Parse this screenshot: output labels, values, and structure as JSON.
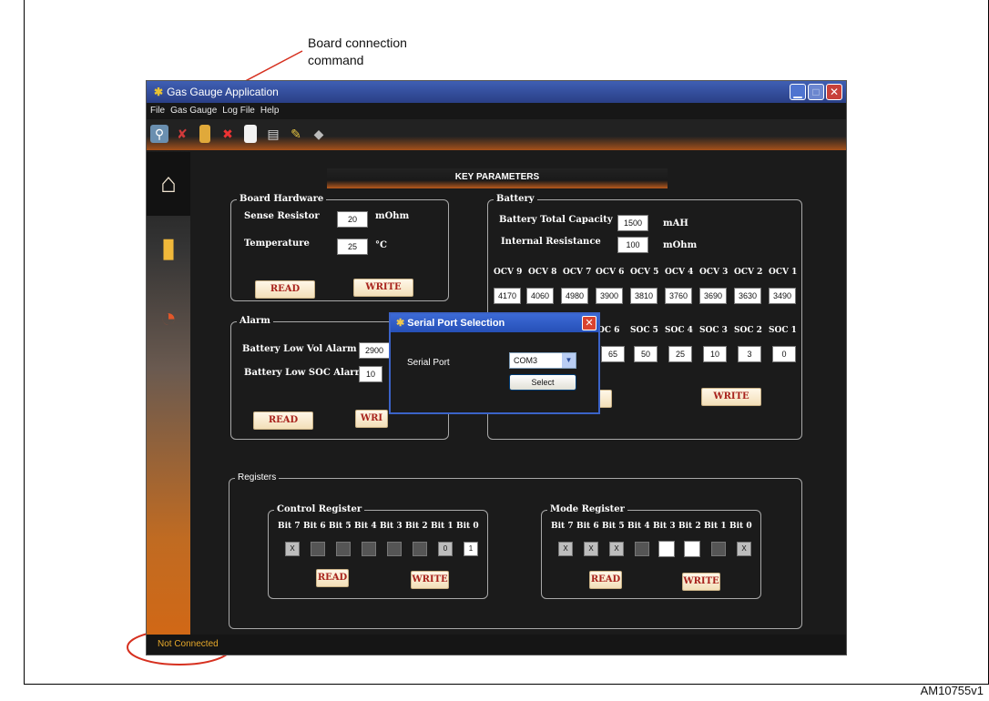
{
  "callout": {
    "line1": "Board connection",
    "line2": "command"
  },
  "figure_label": "AM10755v1",
  "window": {
    "title": "Gas Gauge Application",
    "icon": "app-icon"
  },
  "menu": [
    "File",
    "Gas Gauge",
    "Log File",
    "Help"
  ],
  "toolbar_icons": [
    "connect-icon",
    "disconnect-icon",
    "battery-icon",
    "battery-remove-icon",
    "document-icon",
    "printer-icon",
    "edit-icon",
    "package-icon"
  ],
  "sidebar_icons": [
    "home-icon",
    "battery-level-icon",
    "chart-icon"
  ],
  "status": "Not Connected",
  "key_params_title": "KEY PARAMETERS",
  "board_hardware": {
    "title": "Board Hardware",
    "sense_label": "Sense Resistor",
    "sense_value": "20",
    "sense_unit": "mOhm",
    "temp_label": "Temperature",
    "temp_value": "25",
    "temp_unit": "°C",
    "read": "READ",
    "write": "WRITE"
  },
  "battery": {
    "title": "Battery",
    "cap_label": "Battery Total Capacity",
    "cap_value": "1500",
    "cap_unit": "mAH",
    "res_label": "Internal Resistance",
    "res_value": "100",
    "res_unit": "mOhm",
    "ocv_labels": [
      "OCV 9",
      "OCV 8",
      "OCV 7",
      "OCV 6",
      "OCV 5",
      "OCV 4",
      "OCV 3",
      "OCV 2",
      "OCV 1"
    ],
    "ocv_values": [
      "4170",
      "4060",
      "4980",
      "3900",
      "3810",
      "3760",
      "3690",
      "3630",
      "3490"
    ],
    "soc_labels": [
      "OC 6",
      "SOC 5",
      "SOC 4",
      "SOC 3",
      "SOC 2",
      "SOC 1"
    ],
    "soc_values": [
      "65",
      "50",
      "25",
      "10",
      "3",
      "0"
    ],
    "write": "WRITE"
  },
  "alarm": {
    "title": "Alarm",
    "vol_label": "Battery Low Vol Alarm",
    "vol_value": "2900",
    "soc_label": "Battery Low SOC Alarm",
    "soc_value": "10",
    "read": "READ",
    "write": "WRI"
  },
  "registers": {
    "title": "Registers",
    "bit_labels": [
      "Bit 7",
      "Bit 6",
      "Bit 5",
      "Bit 4",
      "Bit 3",
      "Bit 2",
      "Bit 1",
      "Bit 0"
    ],
    "control": {
      "title": "Control Register",
      "bits": [
        "X",
        "",
        "",
        "",
        "",
        "",
        "0",
        "1"
      ],
      "read": "READ",
      "write": "WRITE"
    },
    "mode": {
      "title": "Mode Register",
      "bits": [
        "X",
        "X",
        "X",
        "",
        "",
        "",
        "",
        "X"
      ],
      "read": "READ",
      "write": "WRITE"
    }
  },
  "dialog": {
    "title": "Serial Port Selection",
    "port_label": "Serial Port",
    "port_value": "COM3",
    "select": "Select",
    "close": "✕"
  }
}
